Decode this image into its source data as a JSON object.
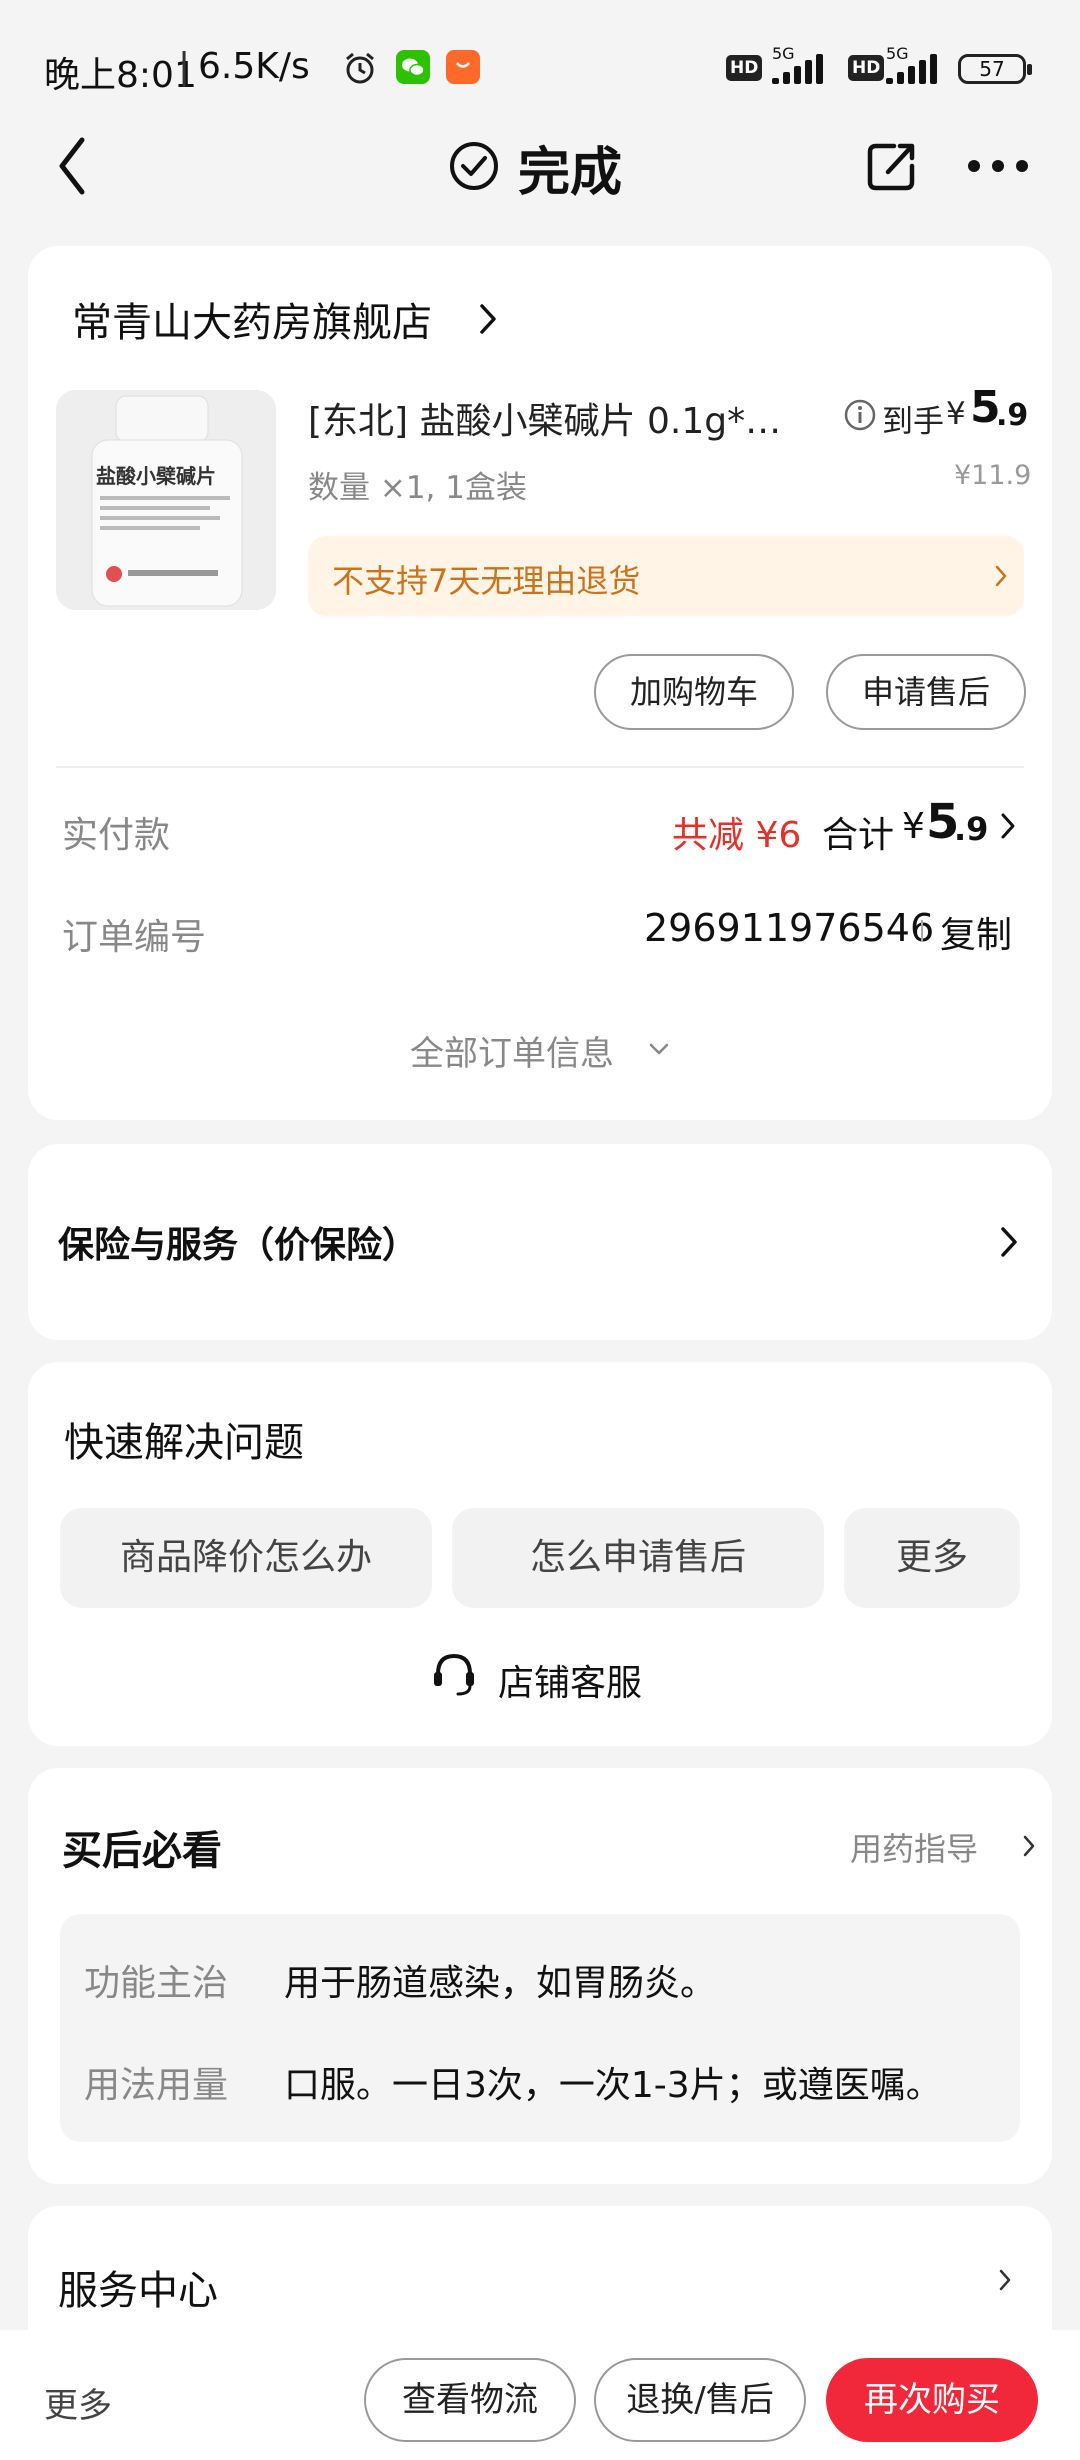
{
  "status_bar": {
    "time": "晚上8:01",
    "speed": "6.5K/s",
    "net1": "5G",
    "net2": "5G",
    "hd": "HD",
    "battery": "57"
  },
  "nav": {
    "title": "完成"
  },
  "store": {
    "name": "常青山大药房旗舰店"
  },
  "product": {
    "title": "[东北] 盐酸小檗碱片 0.1g*…",
    "quantity": "数量 ×1, 1盒装",
    "final_label": "到手",
    "final_currency": "¥",
    "final_int": "5",
    "final_dec": ".9",
    "original_price": "¥11.9",
    "return_notice": "不支持7天无理由退货",
    "img_label": "盐酸小檗碱片",
    "btn_cart": "加购物车",
    "btn_after_sale": "申请售后"
  },
  "payment": {
    "label": "实付款",
    "discount": "共减 ¥6",
    "total_label": "合计",
    "total_currency": "¥",
    "total_int": "5",
    "total_dec": ".9"
  },
  "order": {
    "label": "订单编号",
    "number": "296911976546",
    "copy": "复制",
    "all_info": "全部订单信息"
  },
  "insurance": {
    "label": "保险与服务（价保险）"
  },
  "quick": {
    "title": "快速解决问题",
    "tags": [
      "商品降价怎么办",
      "怎么申请售后",
      "更多"
    ],
    "service": "店铺客服"
  },
  "after": {
    "title": "买后必看",
    "guide": "用药指导",
    "rows": [
      {
        "key": "功能主治",
        "value": "用于肠道感染，如胃肠炎。"
      },
      {
        "key": "用法用量",
        "value": "口服。一日3次，一次1-3片；或遵医嘱。"
      }
    ]
  },
  "service_center": {
    "label": "服务中心"
  },
  "bottom": {
    "more": "更多",
    "logistics": "查看物流",
    "exchange": "退换/售后",
    "rebuy": "再次购买"
  },
  "colors": {
    "accent_red": "#f0283a",
    "discount_red": "#e0322b",
    "warn_bg": "#fff4e6",
    "warn_text": "#c8741d"
  }
}
